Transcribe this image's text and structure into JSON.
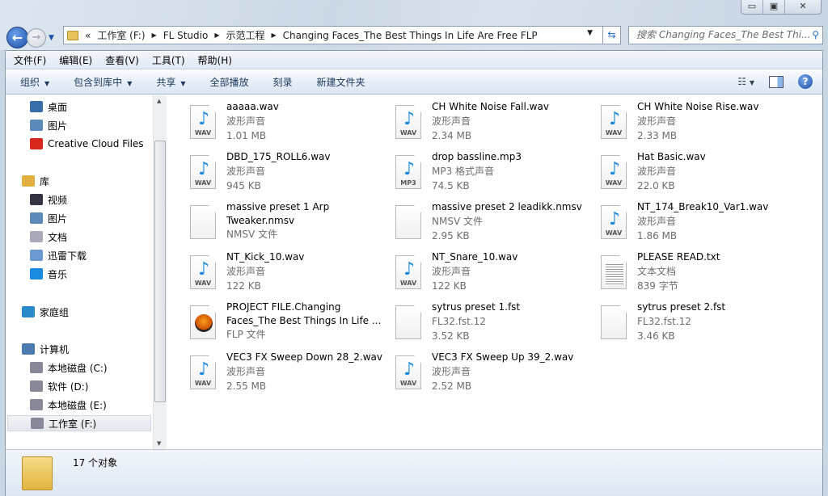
{
  "window": {
    "minimize": "▭",
    "maximize": "▣",
    "close": "✕"
  },
  "address": {
    "crumbs": [
      "«",
      "工作室 (F:)",
      "FL Studio",
      "示范工程",
      "Changing Faces_The Best Things In Life Are Free FLP"
    ]
  },
  "search": {
    "placeholder": "搜索 Changing Faces_The Best Thi..."
  },
  "menu": [
    "文件(F)",
    "编辑(E)",
    "查看(V)",
    "工具(T)",
    "帮助(H)"
  ],
  "toolbar": {
    "organize": "组织",
    "include": "包含到库中",
    "share": "共享",
    "play_all": "全部播放",
    "burn": "刻录",
    "new_folder": "新建文件夹"
  },
  "nav": [
    {
      "label": "桌面",
      "color": "#3a6ea8"
    },
    {
      "label": "图片",
      "color": "#5a8ab8"
    },
    {
      "label": "Creative Cloud Files",
      "color": "#d8261c"
    },
    {
      "label": "库",
      "color": "#e0b040"
    },
    {
      "label": "视频",
      "color": "#334"
    },
    {
      "label": "图片",
      "color": "#5a8ab8"
    },
    {
      "label": "文档",
      "color": "#aab"
    },
    {
      "label": "迅雷下载",
      "color": "#6a9ad0"
    },
    {
      "label": "音乐",
      "color": "#1a8ae0"
    },
    {
      "label": "家庭组",
      "color": "#2a8ac8"
    },
    {
      "label": "计算机",
      "color": "#4a7ab0"
    },
    {
      "label": "本地磁盘 (C:)",
      "color": "#889"
    },
    {
      "label": "软件 (D:)",
      "color": "#889"
    },
    {
      "label": "本地磁盘 (E:)",
      "color": "#889"
    },
    {
      "label": "工作室 (F:)",
      "color": "#889"
    }
  ],
  "files": [
    {
      "name": "aaaaa.wav",
      "type": "波形声音",
      "size": "1.01 MB",
      "icon": "wav"
    },
    {
      "name": "CH White Noise Fall.wav",
      "type": "波形声音",
      "size": "2.34 MB",
      "icon": "wav"
    },
    {
      "name": "CH White Noise Rise.wav",
      "type": "波形声音",
      "size": "2.33 MB",
      "icon": "wav"
    },
    {
      "name": "DBD_175_ROLL6.wav",
      "type": "波形声音",
      "size": "945 KB",
      "icon": "wav"
    },
    {
      "name": "drop bassline.mp3",
      "type": "MP3 格式声音",
      "size": "74.5 KB",
      "icon": "mp3"
    },
    {
      "name": "Hat Basic.wav",
      "type": "波形声音",
      "size": "22.0 KB",
      "icon": "wav"
    },
    {
      "name": "massive preset 1 Arp",
      "name2": "Tweaker.nmsv",
      "type": "NMSV 文件",
      "size": "",
      "icon": "blank"
    },
    {
      "name": "massive preset 2 leadikk.nmsv",
      "type": "NMSV 文件",
      "size": "2.95 KB",
      "icon": "blank"
    },
    {
      "name": "NT_174_Break10_Var1.wav",
      "type": "波形声音",
      "size": "1.86 MB",
      "icon": "wav"
    },
    {
      "name": "NT_Kick_10.wav",
      "type": "波形声音",
      "size": "122 KB",
      "icon": "wav"
    },
    {
      "name": "NT_Snare_10.wav",
      "type": "波形声音",
      "size": "122 KB",
      "icon": "wav"
    },
    {
      "name": "PLEASE READ.txt",
      "type": "文本文档",
      "size": "839 字节",
      "icon": "txt"
    },
    {
      "name": "PROJECT FILE.Changing",
      "name2": "Faces_The Best Things In Life ...",
      "type": "FLP 文件",
      "size": "",
      "icon": "flp"
    },
    {
      "name": "sytrus preset 1.fst",
      "type": "FL32.fst.12",
      "size": "3.52 KB",
      "icon": "blank"
    },
    {
      "name": "sytrus preset 2.fst",
      "type": "FL32.fst.12",
      "size": "3.46 KB",
      "icon": "blank"
    },
    {
      "name": "VEC3 FX Sweep Down 28_2.wav",
      "type": "波形声音",
      "size": "2.55 MB",
      "icon": "wav"
    },
    {
      "name": "VEC3 FX Sweep Up 39_2.wav",
      "type": "波形声音",
      "size": "2.52 MB",
      "icon": "wav"
    }
  ],
  "status": {
    "count": "17 个对象"
  }
}
